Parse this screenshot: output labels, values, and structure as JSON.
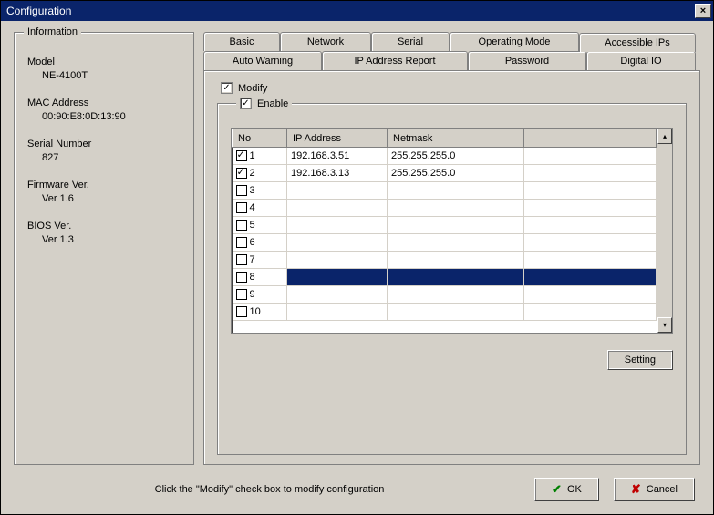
{
  "window": {
    "title": "Configuration"
  },
  "info": {
    "legend": "Information",
    "model_label": "Model",
    "model_value": "NE-4100T",
    "mac_label": "MAC Address",
    "mac_value": "00:90:E8:0D:13:90",
    "serial_label": "Serial Number",
    "serial_value": "827",
    "fw_label": "Firmware Ver.",
    "fw_value": "Ver 1.6",
    "bios_label": "BIOS Ver.",
    "bios_value": "Ver 1.3"
  },
  "tabs": {
    "back": [
      "Auto Warning",
      "IP Address Report",
      "Password",
      "Digital IO"
    ],
    "front": [
      "Basic",
      "Network",
      "Serial",
      "Operating Mode",
      "Accessible IPs"
    ],
    "active": "Accessible IPs"
  },
  "modify": {
    "label": "Modify",
    "checked": true
  },
  "enable": {
    "label": "Enable",
    "checked": true
  },
  "table": {
    "columns": [
      "No",
      "IP Address",
      "Netmask"
    ],
    "rows": [
      {
        "checked": true,
        "no": "1",
        "ip": "192.168.3.51",
        "mask": "255.255.255.0",
        "selected": false
      },
      {
        "checked": true,
        "no": "2",
        "ip": "192.168.3.13",
        "mask": "255.255.255.0",
        "selected": false
      },
      {
        "checked": false,
        "no": "3",
        "ip": "",
        "mask": "",
        "selected": false
      },
      {
        "checked": false,
        "no": "4",
        "ip": "",
        "mask": "",
        "selected": false
      },
      {
        "checked": false,
        "no": "5",
        "ip": "",
        "mask": "",
        "selected": false
      },
      {
        "checked": false,
        "no": "6",
        "ip": "",
        "mask": "",
        "selected": false
      },
      {
        "checked": false,
        "no": "7",
        "ip": "",
        "mask": "",
        "selected": false
      },
      {
        "checked": false,
        "no": "8",
        "ip": "",
        "mask": "",
        "selected": true
      },
      {
        "checked": false,
        "no": "9",
        "ip": "",
        "mask": "",
        "selected": false
      },
      {
        "checked": false,
        "no": "10",
        "ip": "",
        "mask": "",
        "selected": false
      }
    ]
  },
  "buttons": {
    "setting": "Setting",
    "ok": "OK",
    "cancel": "Cancel"
  },
  "hint": "Click the \"Modify\" check box to modify configuration"
}
